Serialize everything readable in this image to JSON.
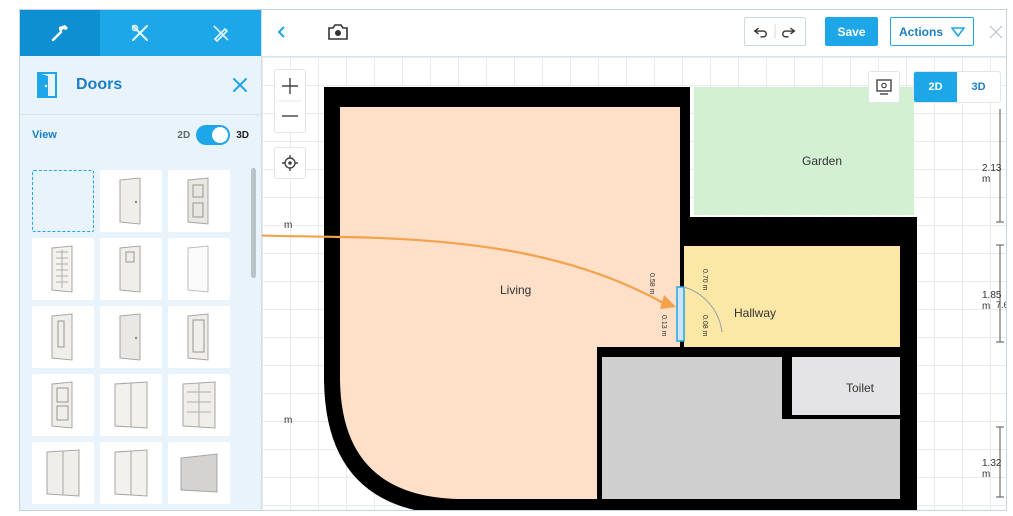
{
  "panel": {
    "tabs": [
      "build-icon",
      "tools-icon",
      "edit-icon"
    ],
    "title": "Doors",
    "view_label": "View",
    "view_2d": "2D",
    "view_3d": "3D"
  },
  "toolbar": {
    "save_label": "Save",
    "actions_label": "Actions"
  },
  "canvas": {
    "mode_2d": "2D",
    "mode_3d": "3D",
    "rooms": {
      "living": "Living",
      "garden": "Garden",
      "hallway": "Hallway",
      "toilet": "Toilet"
    },
    "measurements": {
      "m1": "2.13 m",
      "m2": "1.85 m",
      "m3": "1.32 m",
      "m4": "7.6",
      "left_m1": "m",
      "left_m2": "m",
      "door_a": "0.70 m",
      "door_b": "0.13 m",
      "door_c": "0.08 m",
      "door_d": "0.58 m"
    }
  },
  "colors": {
    "accent": "#1ea7e8",
    "living": "#fde0c7",
    "garden": "#d3f0d2",
    "hallway": "#fbe7a6",
    "toilet": "#e4e4e6",
    "storage": "#cfcfcf",
    "arrow": "#f4a14b"
  }
}
